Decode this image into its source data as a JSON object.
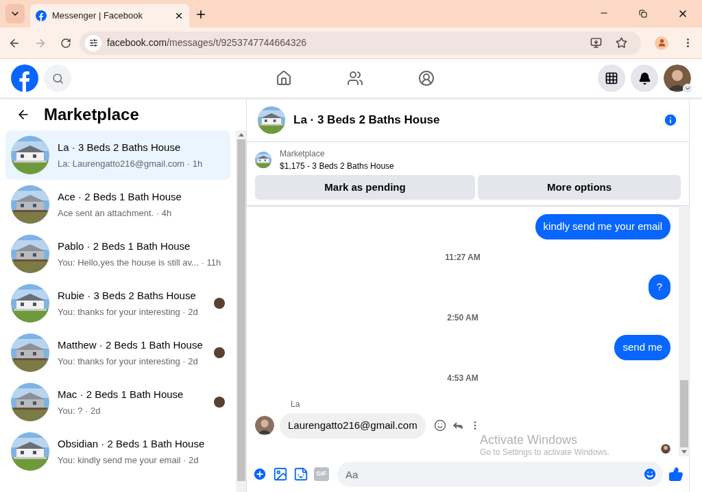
{
  "browser": {
    "tab_title": "Messenger | Facebook",
    "url_domain": "facebook.com",
    "url_path": "/messages/t/9253747744664326"
  },
  "sidebar": {
    "title": "Marketplace",
    "conversations": [
      {
        "title": "La · 3 Beds 2 Baths House",
        "preview": "La: Laurengatto216@gmail.com · 1h",
        "selected": true,
        "seen": false
      },
      {
        "title": "Ace · 2 Beds 1 Bath House",
        "preview": "Ace sent an attachment. · 4h",
        "selected": false,
        "seen": false
      },
      {
        "title": "Pablo · 2 Beds 1 Bath House",
        "preview": "You: Hello,yes the house is still av...  · 11h",
        "selected": false,
        "seen": false
      },
      {
        "title": "Rubie · 3 Beds 2 Baths House",
        "preview": "You: thanks for your interesting · 2d",
        "selected": false,
        "seen": true
      },
      {
        "title": "Matthew · 2 Beds 1 Bath House",
        "preview": "You: thanks for your interesting · 2d",
        "selected": false,
        "seen": true
      },
      {
        "title": "Mac · 2 Beds 1 Bath House",
        "preview": "You: ? · 2d",
        "selected": false,
        "seen": true
      },
      {
        "title": "Obsidian · 2 Beds 1 Bath House",
        "preview": "You: kindly send me your email · 2d",
        "selected": false,
        "seen": false
      }
    ]
  },
  "chat": {
    "title": "La · 3 Beds 2 Baths House",
    "listing": {
      "label": "Marketplace",
      "price_title": "$1,175 - 3 Beds 2 Baths House"
    },
    "buttons": [
      "Mark as pending",
      "More options"
    ],
    "messages": [
      {
        "kind": "outgoing",
        "text": "kindly send me your email"
      },
      {
        "kind": "time",
        "text": "11:27 AM"
      },
      {
        "kind": "outgoing",
        "text": "?"
      },
      {
        "kind": "time",
        "text": "2:50 AM"
      },
      {
        "kind": "outgoing",
        "text": "send me"
      },
      {
        "kind": "time",
        "text": "4:53 AM"
      },
      {
        "kind": "incoming",
        "sender": "La",
        "text": "Laurengatto216@gmail.com"
      }
    ],
    "composer": {
      "placeholder": "Aa",
      "gif_label": "GIF"
    }
  },
  "os_notice": {
    "title": "Activate Windows",
    "subtitle": "Go to Settings to activate Windows."
  }
}
